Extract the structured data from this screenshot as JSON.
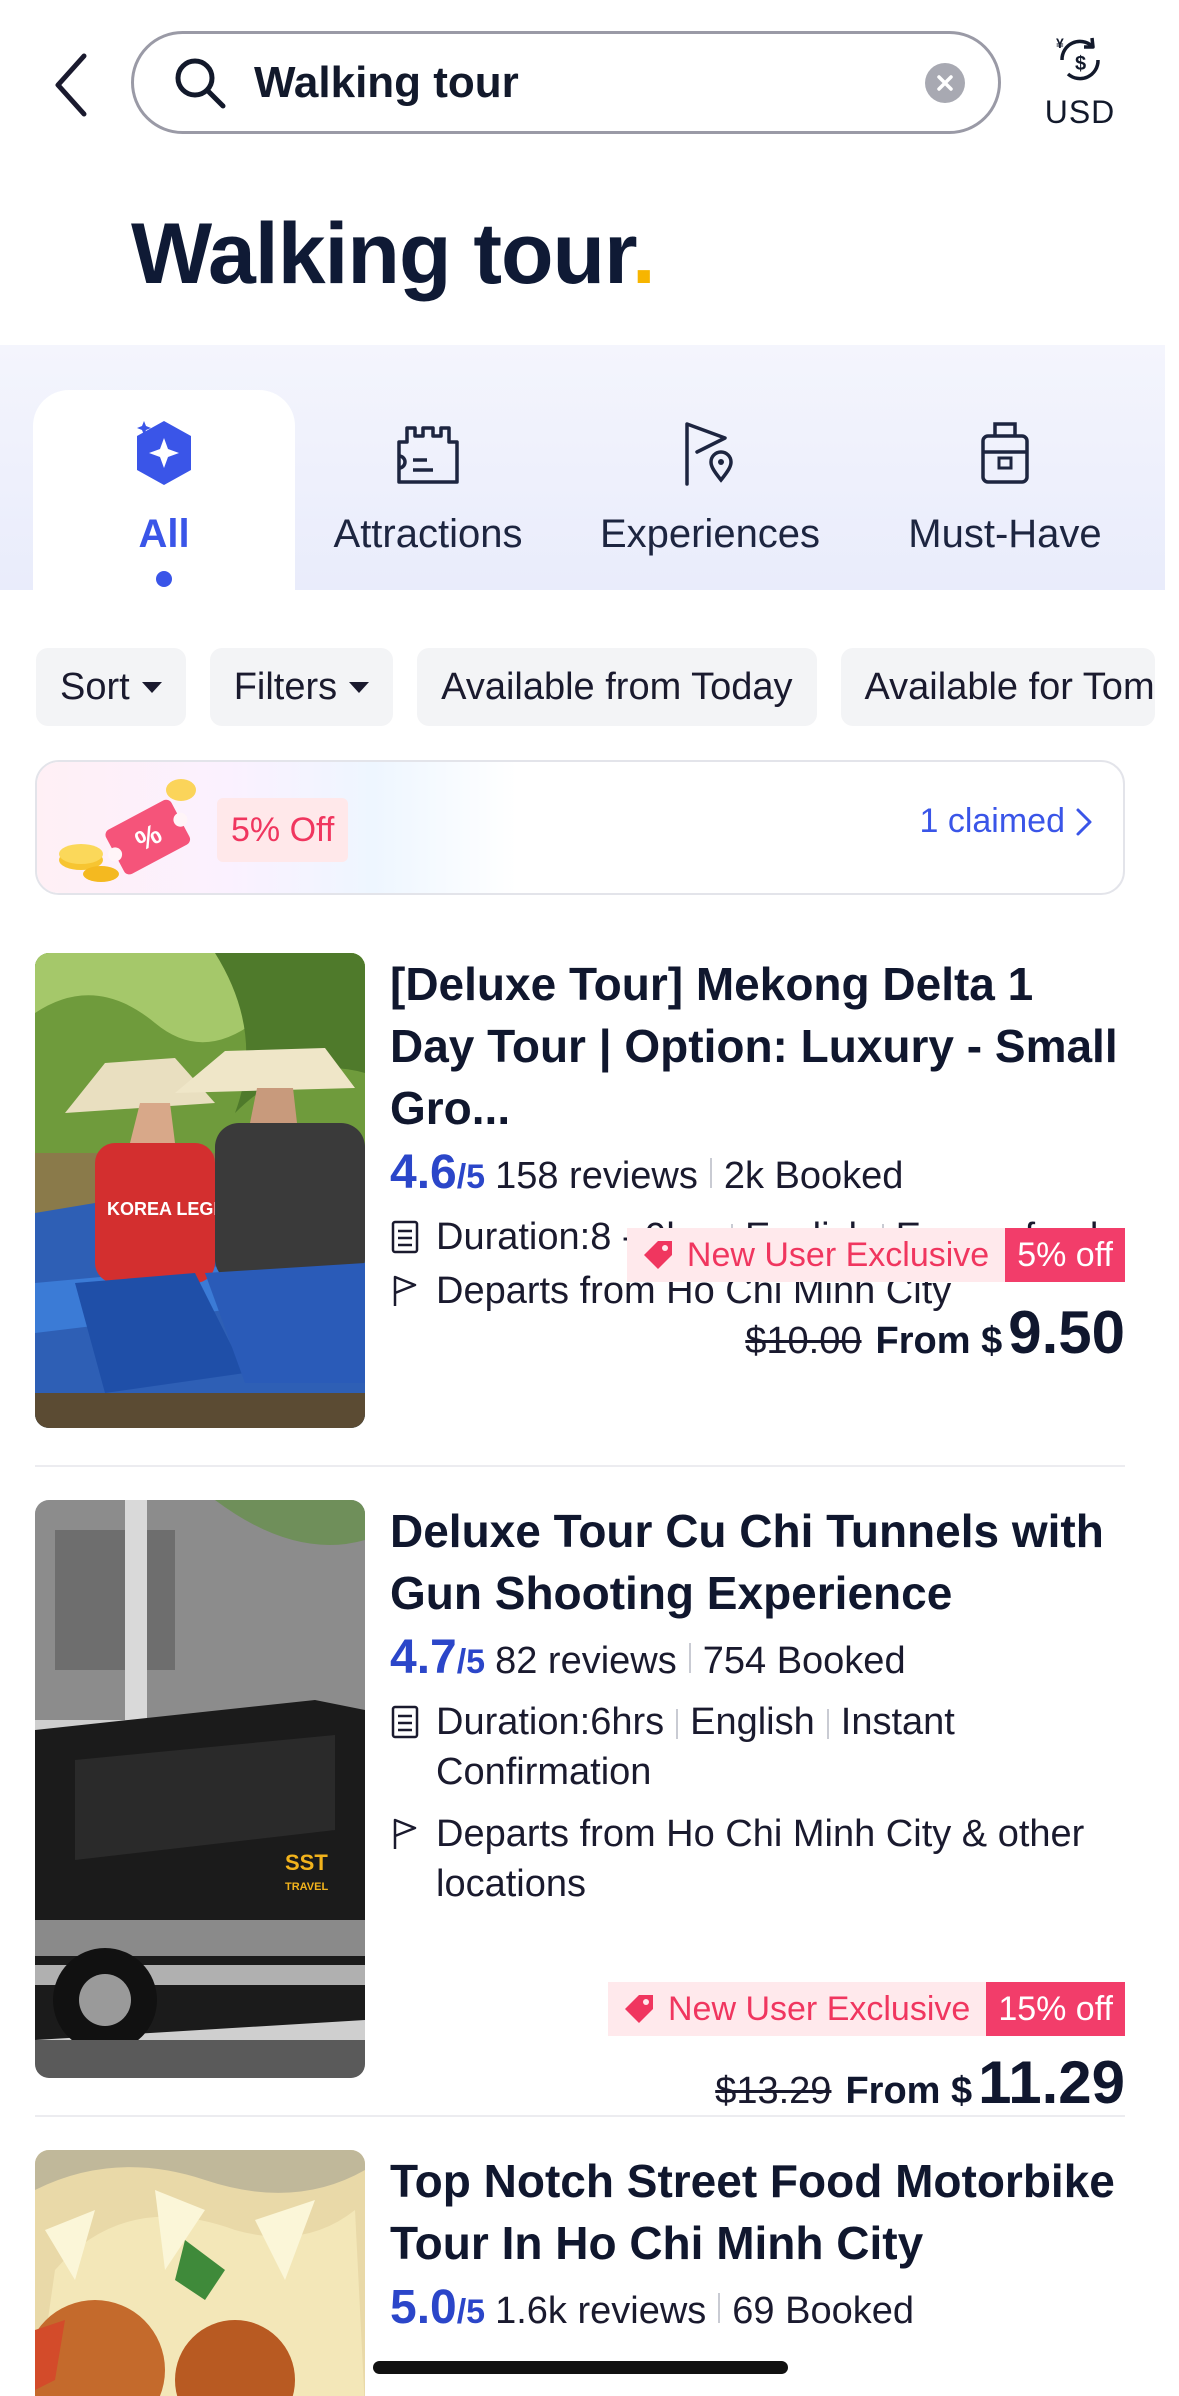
{
  "header": {
    "search_value": "Walking tour",
    "currency_label": "USD"
  },
  "page_title": "Walking tour",
  "categories": [
    {
      "label": "All",
      "active": true
    },
    {
      "label": "Attractions"
    },
    {
      "label": "Experiences"
    },
    {
      "label": "Must-Have"
    }
  ],
  "filters": {
    "sort_label": "Sort",
    "filters_label": "Filters",
    "chip_today": "Available from Today",
    "chip_tomorrow": "Available for Tom"
  },
  "coupon": {
    "badge": "5% Off",
    "claimed": "1 claimed"
  },
  "products": [
    {
      "title": "[Deluxe Tour] Mekong Delta 1 Day Tour | Option: Luxury - Small Gro...",
      "rating": "4.6",
      "rating_out_of": "/5",
      "reviews": "158 reviews",
      "booked": "2k Booked",
      "duration": "Duration:8 - 9hrs",
      "language": "English",
      "policy": "Easy refund",
      "departs": "Departs from Ho Chi Minh City",
      "promo_label": "New User Exclusive",
      "promo_discount": "5% off",
      "old_price": "$10.00",
      "from_label": "From $",
      "price": "9.50"
    },
    {
      "title": "Deluxe Tour Cu Chi Tunnels with Gun Shooting Experience",
      "rating": "4.7",
      "rating_out_of": "/5",
      "reviews": "82 reviews",
      "booked": "754 Booked",
      "duration": "Duration:6hrs",
      "language": "English",
      "policy": "Instant Confirmation",
      "departs": "Departs from Ho Chi Minh City & other locations",
      "promo_label": "New User Exclusive",
      "promo_discount": "15% off",
      "old_price": "$13.29",
      "from_label": "From $",
      "price": "11.29",
      "image_sign_text": "SST TRAVEL"
    },
    {
      "title": "Top Notch Street Food Motorbike Tour In Ho Chi Minh City",
      "rating": "5.0",
      "rating_out_of": "/5",
      "reviews": "1.6k reviews",
      "booked": "69 Booked"
    }
  ],
  "image_text": {
    "shirt_text": "KOREA LEGEND"
  },
  "colors": {
    "accent": "#3a55e8",
    "rating": "#2b46c9",
    "promo": "#f23d6a",
    "title_dot": "#f7b500"
  }
}
